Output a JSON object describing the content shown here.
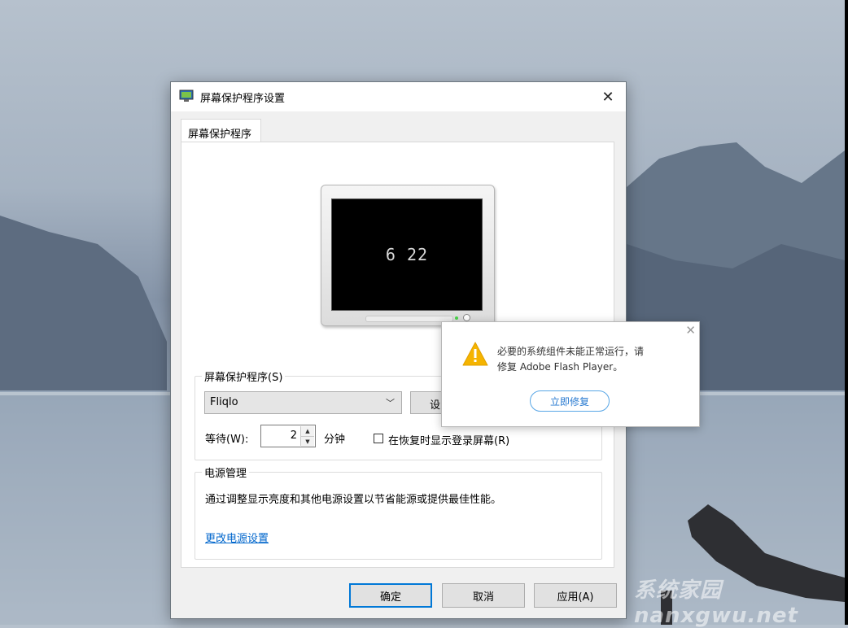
{
  "dialog": {
    "title": "屏幕保护程序设置",
    "close_glyph": "✕",
    "tab_label": "屏幕保护程序",
    "preview_clock": "6 22",
    "screensaver_group": {
      "title": "屏幕保护程序(S)",
      "selected": "Fliqlo",
      "settings_button": "设",
      "wait_label": "等待(W):",
      "wait_value": "2",
      "minutes_label": "分钟",
      "resume_checkbox_label": "在恢复时显示登录屏幕(R)",
      "resume_checked": false
    },
    "power_group": {
      "title": "电源管理",
      "description": "通过调整显示亮度和其他电源设置以节省能源或提供最佳性能。",
      "link": "更改电源设置"
    },
    "buttons": {
      "ok": "确定",
      "cancel": "取消",
      "apply": "应用(A)"
    }
  },
  "flash_popup": {
    "close_glyph": "✕",
    "message_line1": "必要的系统组件未能正常运行，请",
    "message_line2": "修复 Adobe Flash Player。",
    "repair_button": "立即修复",
    "icon": "warning-icon"
  },
  "watermark": "系统家园nanxgwu.net",
  "colors": {
    "accent": "#0078d7",
    "link": "#0066cc",
    "warning": "#f5b400"
  }
}
